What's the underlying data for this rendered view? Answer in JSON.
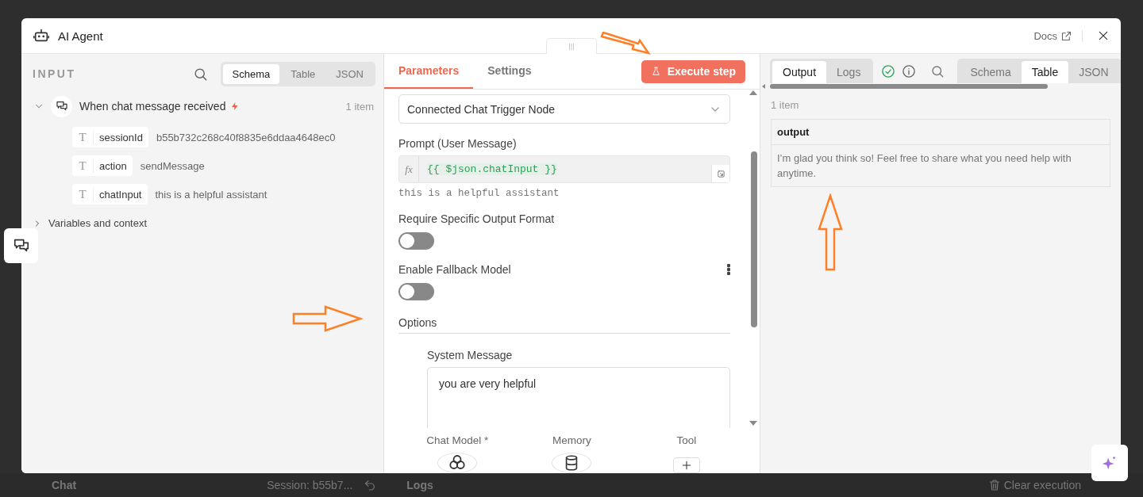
{
  "modal": {
    "title": "AI Agent",
    "docs_link": "Docs"
  },
  "input_panel": {
    "heading": "INPUT",
    "view_tabs": [
      {
        "label": "Schema",
        "selected": true
      },
      {
        "label": "Table",
        "selected": false
      },
      {
        "label": "JSON",
        "selected": false
      }
    ],
    "node": {
      "name": "When chat message received",
      "count": "1 item",
      "expanded": true,
      "fields": [
        {
          "type": "T",
          "name": "sessionId",
          "value": "b55b732c268c40f8835e6ddaa4648ec0"
        },
        {
          "type": "T",
          "name": "action",
          "value": "sendMessage"
        },
        {
          "type": "T",
          "name": "chatInput",
          "value": "this is a helpful assistant"
        }
      ]
    },
    "variables": {
      "label": "Variables and context",
      "expanded": false
    }
  },
  "parameters_panel": {
    "tabs": [
      {
        "label": "Parameters",
        "selected": true
      },
      {
        "label": "Settings",
        "selected": false
      }
    ],
    "execute_button": "Execute step",
    "source_select": {
      "value": "Connected Chat Trigger Node"
    },
    "prompt": {
      "label": "Prompt (User Message)",
      "fx": "fx",
      "expression": "{{ $json.chatInput }}",
      "preview": "this is a helpful assistant"
    },
    "toggles": [
      {
        "label": "Require Specific Output Format",
        "on": false,
        "menu": false
      },
      {
        "label": "Enable Fallback Model",
        "on": false,
        "menu": true
      }
    ],
    "options": {
      "heading": "Options",
      "system_message": {
        "label": "System Message",
        "value": "you are very helpful"
      }
    },
    "sub_nodes": [
      {
        "label": "Chat Model *",
        "kind": "model"
      },
      {
        "label": "Memory",
        "kind": "memory"
      },
      {
        "label": "Tool",
        "kind": "add"
      }
    ]
  },
  "output_panel": {
    "tabs": [
      {
        "label": "Output",
        "selected": true
      },
      {
        "label": "Logs",
        "selected": false
      }
    ],
    "succeeded": true,
    "view_tabs": [
      {
        "label": "Schema",
        "selected": false
      },
      {
        "label": "Table",
        "selected": true
      },
      {
        "label": "JSON",
        "selected": false
      }
    ],
    "count": "1 item",
    "table": {
      "columns": [
        "output"
      ],
      "rows": [
        [
          "I’m glad you think so! Feel free to share what you need help with anytime."
        ]
      ]
    }
  },
  "bottom_bar": {
    "chat": "Chat",
    "session": "Session: b55b7...",
    "logs": "Logs",
    "clear": "Clear execution"
  }
}
